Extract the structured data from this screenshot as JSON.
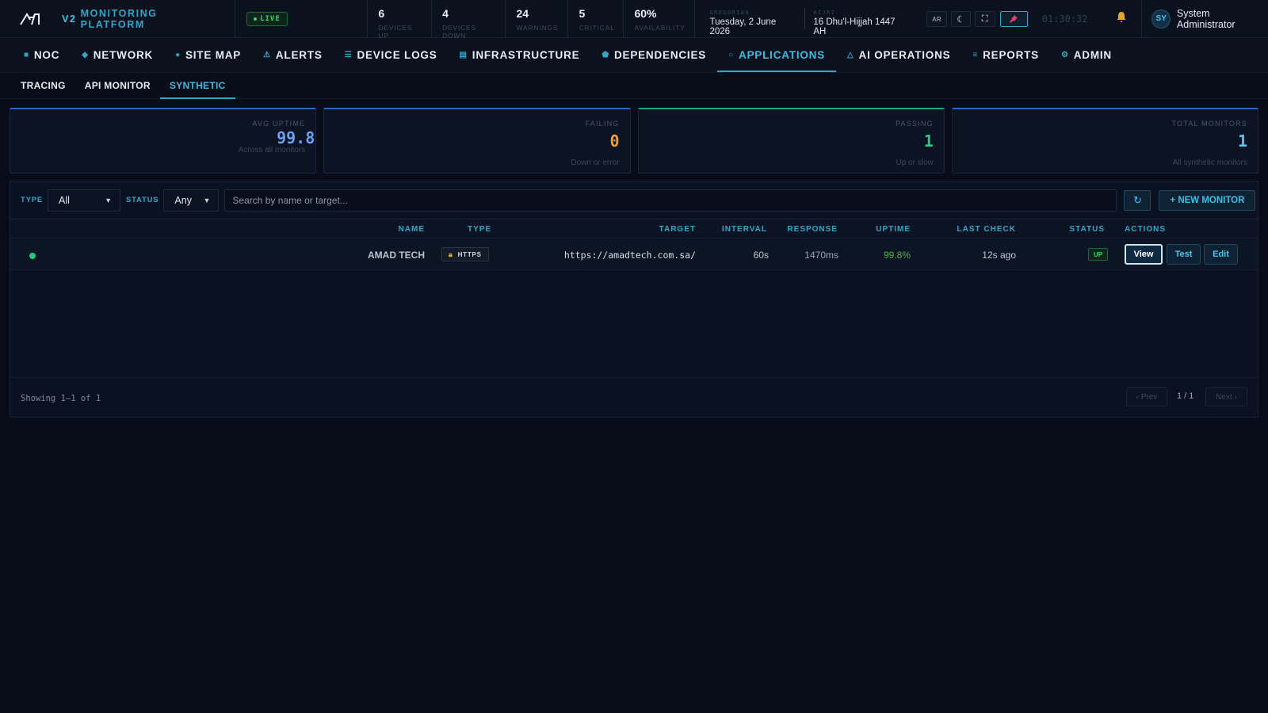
{
  "header": {
    "title_v2": "V2",
    "title_rest": "MONITORING PLATFORM",
    "live_label": "LIVE",
    "stats": [
      {
        "value": "6",
        "label": "DEVICES UP"
      },
      {
        "value": "4",
        "label": "DEVICES DOWN"
      },
      {
        "value": "24",
        "label": "WARNINGS"
      },
      {
        "value": "5",
        "label": "CRITICAL"
      },
      {
        "value": "60%",
        "label": "AVAILABILITY"
      }
    ],
    "gregorian_label": "GREGORIAN",
    "gregorian_date": "Tuesday, 2 June 2026",
    "hijri_label": "HIJRI",
    "hijri_date": "16 Dhu'l-Hijjah 1447 AH",
    "lang_button": "AR",
    "clock": "01:30:32",
    "user_initials": "SY",
    "user_name": "System Administrator"
  },
  "main_nav": [
    {
      "label": "NOC",
      "icon": "square-icon"
    },
    {
      "label": "NETWORK",
      "icon": "diamond-icon"
    },
    {
      "label": "SITE MAP",
      "icon": "globe-icon"
    },
    {
      "label": "ALERTS",
      "icon": "warning-icon"
    },
    {
      "label": "DEVICE LOGS",
      "icon": "list-icon"
    },
    {
      "label": "INFRASTRUCTURE",
      "icon": "server-icon"
    },
    {
      "label": "DEPENDENCIES",
      "icon": "pentagon-icon"
    },
    {
      "label": "APPLICATIONS",
      "icon": "circle-icon",
      "active": true
    },
    {
      "label": "AI OPERATIONS",
      "icon": "triangle-icon"
    },
    {
      "label": "REPORTS",
      "icon": "lines-icon"
    },
    {
      "label": "ADMIN",
      "icon": "gear-icon"
    }
  ],
  "sub_nav": [
    {
      "label": "TRACING"
    },
    {
      "label": "API MONITOR"
    },
    {
      "label": "SYNTHETIC",
      "active": true
    }
  ],
  "kpis": [
    {
      "label": "AVG UPTIME",
      "value": "99.8",
      "sub": "Across all monitors",
      "color": "#6aa0f0"
    },
    {
      "label": "FAILING",
      "value": "0",
      "sub": "Down or error",
      "color": "#f0a030"
    },
    {
      "label": "PASSING",
      "value": "1",
      "sub": "Up or slow",
      "color": "#2ec88a"
    },
    {
      "label": "TOTAL MONITORS",
      "value": "1",
      "sub": "All synthetic monitors",
      "color": "#56c8f0"
    }
  ],
  "filters": {
    "type_label": "TYPE",
    "type_value": "All",
    "status_label": "STATUS",
    "status_value": "Any",
    "search_placeholder": "Search by name or target...",
    "refresh_icon": "↻",
    "new_monitor_label": "+ NEW MONITOR"
  },
  "table": {
    "columns": [
      "NAME",
      "TYPE",
      "TARGET",
      "INTERVAL",
      "RESPONSE",
      "UPTIME",
      "LAST CHECK",
      "STATUS",
      "ACTIONS"
    ],
    "rows": [
      {
        "name": "AMAD TECH",
        "type": "HTTPS",
        "target": "https://amadtech.com.sa/",
        "interval": "60s",
        "response": "1470ms",
        "uptime": "99.8%",
        "last_check": "12s ago",
        "status": "UP",
        "actions": {
          "view": "View",
          "test": "Test",
          "edit": "Edit"
        }
      }
    ]
  },
  "footer": {
    "showing": "Showing 1–1 of 1",
    "prev": "‹ Prev",
    "page_info": "1 / 1",
    "next": "Next ›"
  },
  "colors": {
    "accent": "#2fa7c9",
    "up": "#3ecf7a",
    "uptime_text": "#4caf50",
    "warning": "#f0a030"
  }
}
